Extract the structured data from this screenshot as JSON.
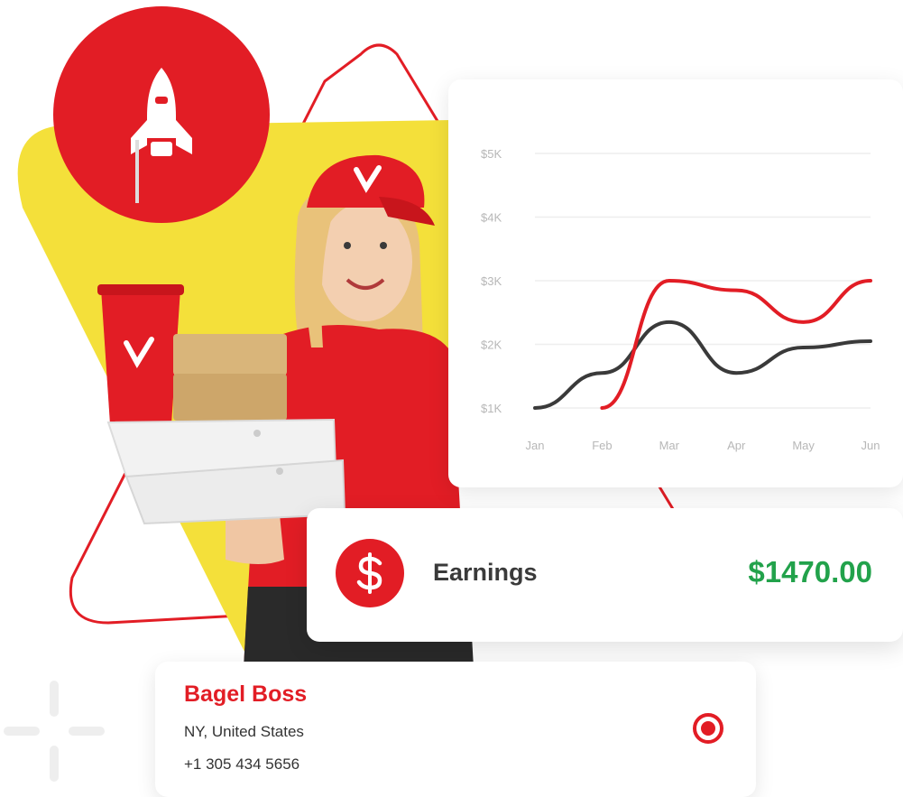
{
  "colors": {
    "brand_red": "#e21d25",
    "brand_yellow": "#f4e03a",
    "earnings_green": "#22a24b",
    "series_dark": "#3a3a3a",
    "grid": "#eeeeee"
  },
  "icons": {
    "rocket": "rocket-icon",
    "dollar": "dollar-icon",
    "record": "record-icon",
    "sparkle": "sparkle-icon"
  },
  "chart_data": {
    "type": "line",
    "categories": [
      "Jan",
      "Feb",
      "Mar",
      "Apr",
      "May",
      "Jun"
    ],
    "y_ticks": [
      "$1K",
      "$2K",
      "$3K",
      "$4K",
      "$5K"
    ],
    "ylim": [
      1000,
      5000
    ],
    "grid": true,
    "series": [
      {
        "color": "#3a3a3a",
        "points": [
          {
            "x": "Jan",
            "y": 1000
          },
          {
            "x": "Feb",
            "y": 1550
          },
          {
            "x": "Mar",
            "y": 2350
          },
          {
            "x": "Apr",
            "y": 1550
          },
          {
            "x": "May",
            "y": 1950
          },
          {
            "x": "Jun",
            "y": 2050
          }
        ]
      },
      {
        "color": "#e21d25",
        "points": [
          {
            "x": "Feb",
            "y": 1000
          },
          {
            "x": "Mar",
            "y": 3000
          },
          {
            "x": "Apr",
            "y": 2850
          },
          {
            "x": "May",
            "y": 2350
          },
          {
            "x": "Jun",
            "y": 3000
          }
        ]
      }
    ]
  },
  "earnings": {
    "label": "Earnings",
    "amount": "$1470.00"
  },
  "store": {
    "name": "Bagel Boss",
    "location": "NY, United States",
    "phone": "+1 305 434 5656"
  }
}
